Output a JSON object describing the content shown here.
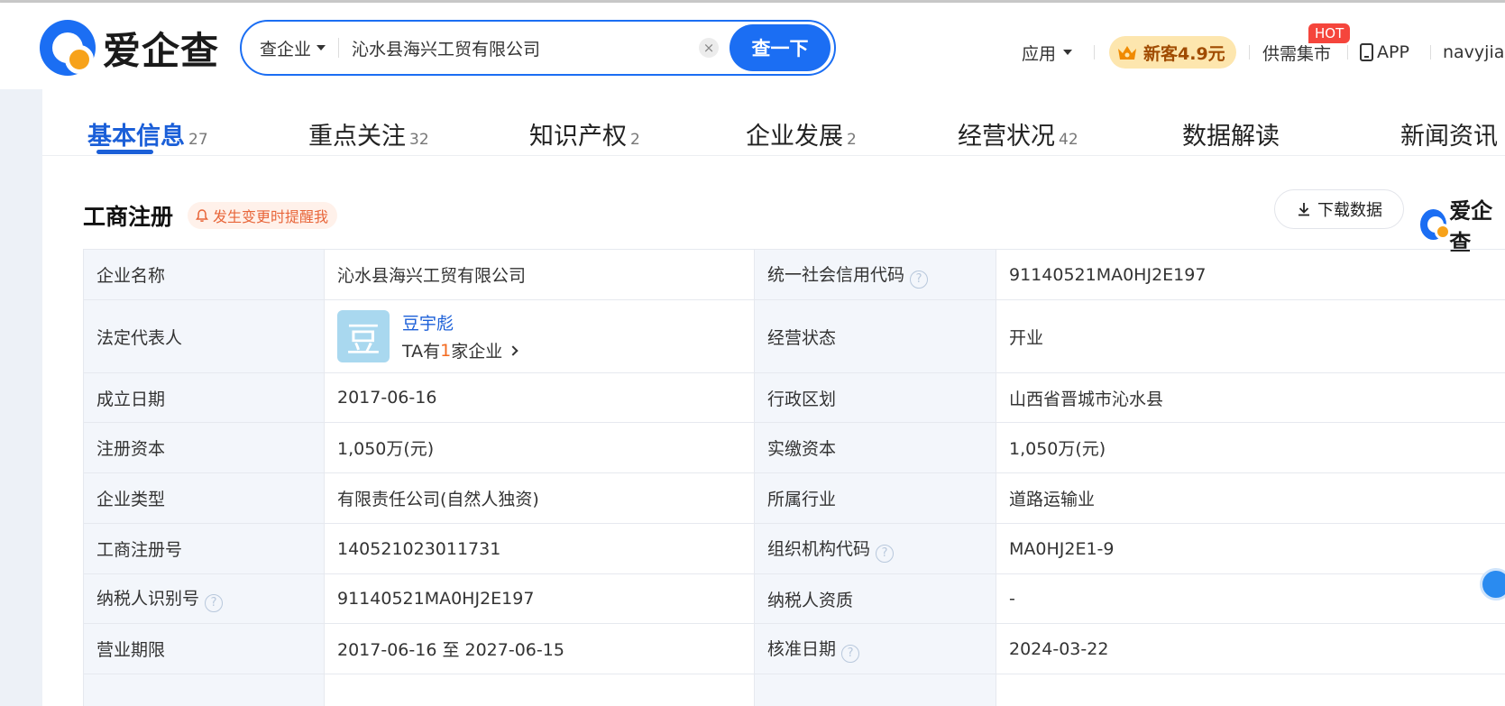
{
  "header": {
    "logo_text": "爱企查",
    "search": {
      "type_label": "查企业",
      "value": "沁水县海兴工贸有限公司",
      "clear_label": "×",
      "button_label": "查一下"
    },
    "nav": {
      "app_label": "应用",
      "promo_label": "新客4.9元",
      "market_label": "供需集市",
      "hot_badge": "HOT",
      "app_download_label": "APP",
      "username": "navyjian"
    }
  },
  "tabs": [
    {
      "label": "基本信息",
      "count": "27"
    },
    {
      "label": "重点关注",
      "count": "32"
    },
    {
      "label": "知识产权",
      "count": "2"
    },
    {
      "label": "企业发展",
      "count": "2"
    },
    {
      "label": "经营状况",
      "count": "42"
    },
    {
      "label": "数据解读",
      "count": ""
    },
    {
      "label": "新闻资讯",
      "count": ""
    }
  ],
  "section": {
    "title": "工商注册",
    "remind_label": "发生变更时提醒我",
    "download_label": "下载数据",
    "watermark_logo": "爱企查"
  },
  "info": {
    "rows": [
      {
        "l1": "企业名称",
        "v1": "沁水县海兴工贸有限公司",
        "l2": "统一社会信用代码",
        "v2": "91140521MA0HJ2E197"
      },
      {
        "l1": "法定代表人",
        "l2": "经营状态",
        "v2": "开业"
      },
      {
        "l1": "成立日期",
        "v1": "2017-06-16",
        "l2": "行政区划",
        "v2": "山西省晋城市沁水县"
      },
      {
        "l1": "注册资本",
        "v1": "1,050万(元)",
        "l2": "实缴资本",
        "v2": "1,050万(元)"
      },
      {
        "l1": "企业类型",
        "v1": "有限责任公司(自然人独资)",
        "l2": "所属行业",
        "v2": "道路运输业"
      },
      {
        "l1": "工商注册号",
        "v1": "140521023011731",
        "l2": "组织机构代码",
        "v2": "MA0HJ2E1-9"
      },
      {
        "l1": "纳税人识别号",
        "v1": "91140521MA0HJ2E197",
        "l2": "纳税人资质",
        "v2": "-"
      },
      {
        "l1": "营业期限",
        "v1": "2017-06-16 至 2027-06-15",
        "l2": "核准日期",
        "v2": "2024-03-22"
      }
    ],
    "legal_rep": {
      "avatar_char": "豆",
      "name": "豆宇彪",
      "sub_prefix": "TA有",
      "sub_count": "1",
      "sub_suffix": "家企业"
    },
    "help_mark": "?"
  }
}
